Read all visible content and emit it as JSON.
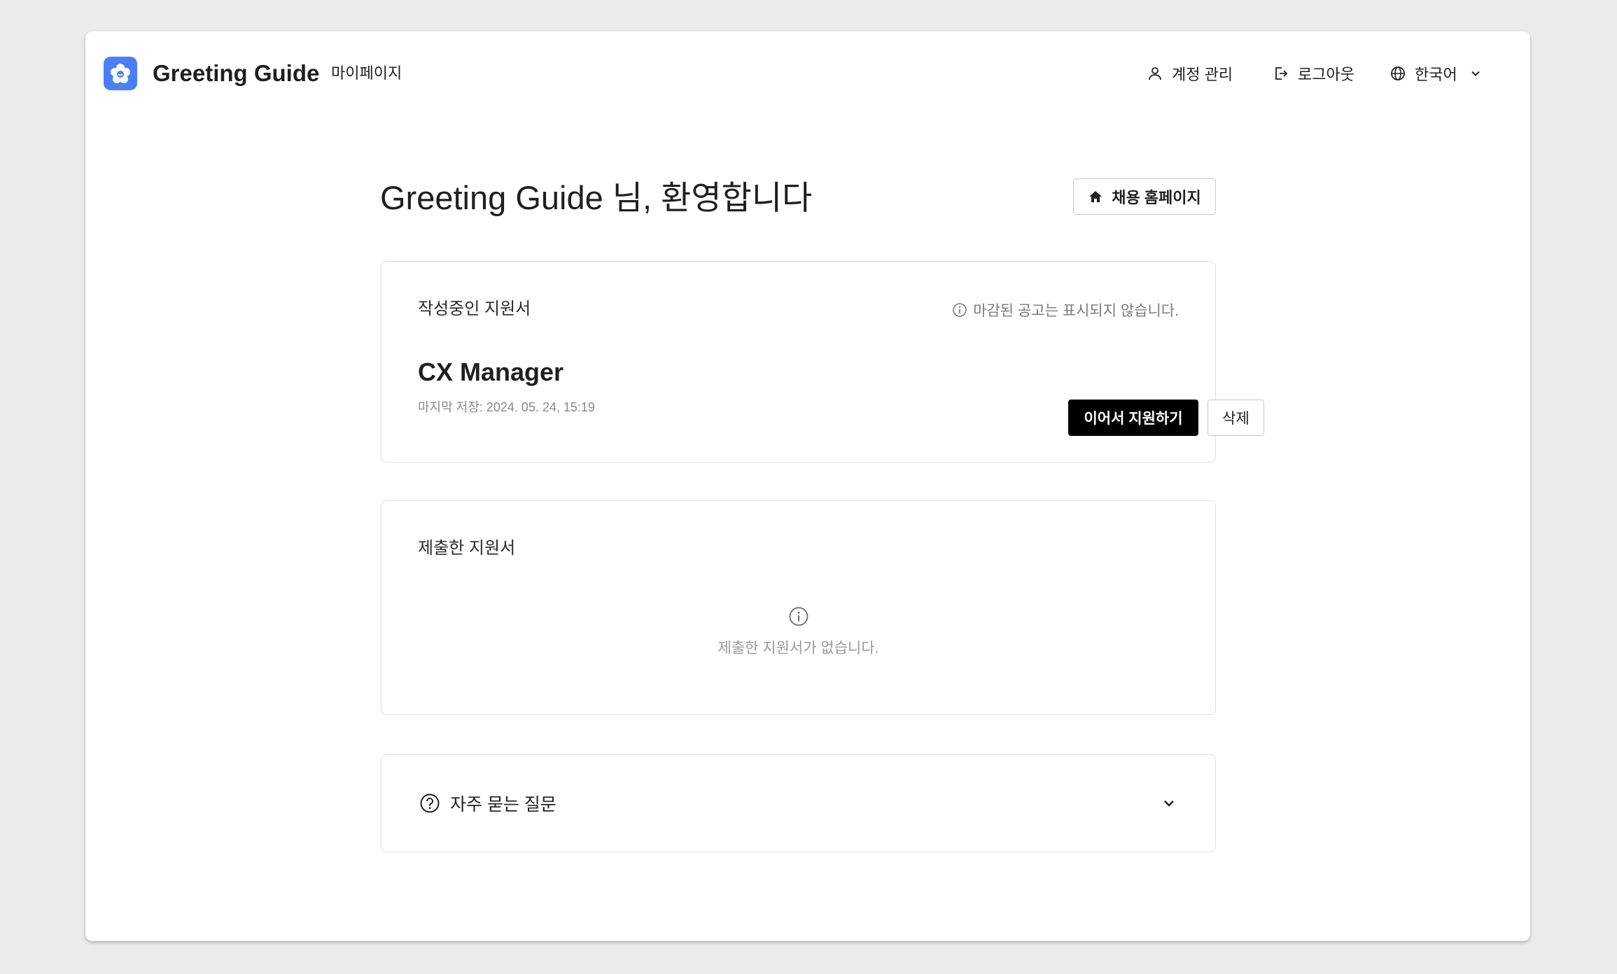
{
  "header": {
    "brand": "Greeting Guide",
    "subtitle": "마이페이지",
    "nav": {
      "account": "계정 관리",
      "logout": "로그아웃",
      "language": "한국어"
    }
  },
  "main": {
    "welcome": "Greeting Guide 님, 환영합니다",
    "home_button": "채용 홈페이지",
    "draft": {
      "title": "작성중인 지원서",
      "notice": "마감된 공고는 표시되지 않습니다.",
      "job_title": "CX Manager",
      "saved_at": "마지막 저장: 2024. 05. 24, 15:19",
      "continue_button": "이어서 지원하기",
      "delete_button": "삭제"
    },
    "submitted": {
      "title": "제출한 지원서",
      "empty_message": "제출한 지원서가 없습니다."
    },
    "faq": {
      "title": "자주 묻는 질문"
    }
  },
  "icons": {
    "logo": "flower-logo-icon",
    "account": "user-icon",
    "logout": "logout-icon",
    "language": "globe-icon",
    "home": "home-icon",
    "info": "info-icon",
    "faq": "question-circle-icon",
    "expand": "chevron-down-icon"
  },
  "colors": {
    "brand": "#4a7ff5",
    "primary_button": "#000000",
    "background": "#ebebeb"
  }
}
